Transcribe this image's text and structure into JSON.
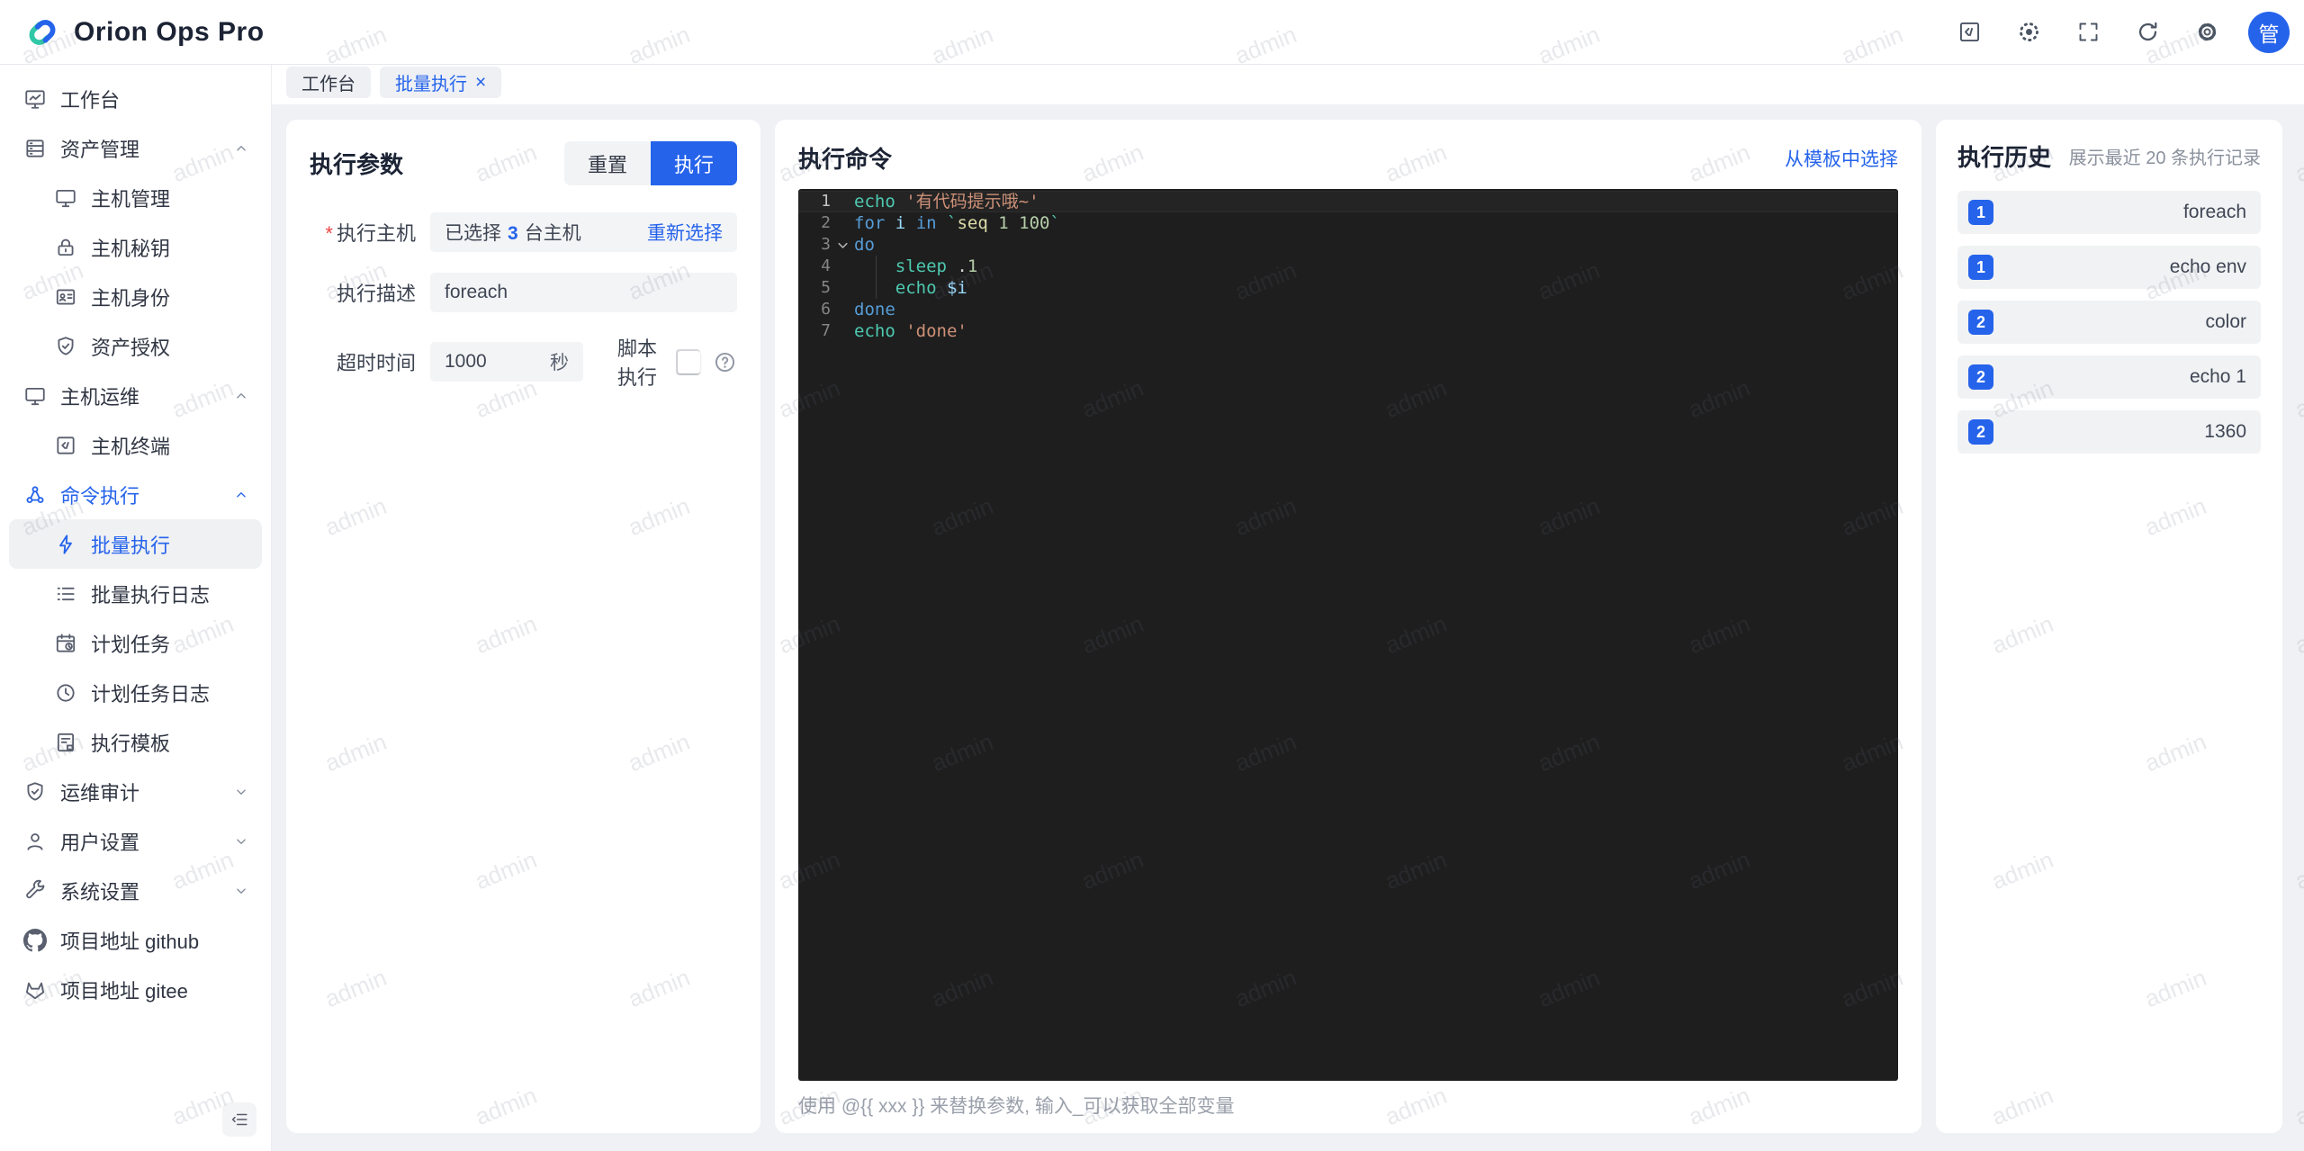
{
  "app": {
    "title": "Orion Ops Pro",
    "watermark": "admin"
  },
  "colors": {
    "primary": "#2563eb",
    "logo_teal": "#2fc7a7",
    "logo_blue": "#2563eb"
  },
  "header": {
    "actions": [
      {
        "name": "code-window-icon",
        "icon": "code-window"
      },
      {
        "name": "theme-sun-icon",
        "icon": "sun"
      },
      {
        "name": "fullscreen-icon",
        "icon": "fullscreen"
      },
      {
        "name": "refresh-icon",
        "icon": "refresh"
      },
      {
        "name": "settings-gear-icon",
        "icon": "gear"
      }
    ],
    "avatar_text": "管"
  },
  "tabs": [
    {
      "label": "工作台",
      "active": false,
      "closable": false
    },
    {
      "label": "批量执行",
      "active": true,
      "closable": true,
      "close_glyph": "×"
    }
  ],
  "sidebar": {
    "items": [
      {
        "label": "工作台",
        "level": 1,
        "icon": "dashboard-monitor-icon"
      },
      {
        "label": "资产管理",
        "level": 1,
        "icon": "server-stack-icon",
        "arrow": "up"
      },
      {
        "label": "主机管理",
        "level": 2,
        "icon": "monitor-icon"
      },
      {
        "label": "主机秘钥",
        "level": 2,
        "icon": "lock-icon"
      },
      {
        "label": "主机身份",
        "level": 2,
        "icon": "id-card-icon"
      },
      {
        "label": "资产授权",
        "level": 2,
        "icon": "shield-check-icon"
      },
      {
        "label": "主机运维",
        "level": 1,
        "icon": "monitor-icon",
        "arrow": "up"
      },
      {
        "label": "主机终端",
        "level": 2,
        "icon": "terminal-icon"
      },
      {
        "label": "命令执行",
        "level": 1,
        "icon": "cluster-icon",
        "arrow": "up",
        "blue": true
      },
      {
        "label": "批量执行",
        "level": 2,
        "icon": "lightning-icon",
        "active": true
      },
      {
        "label": "批量执行日志",
        "level": 2,
        "icon": "list-icon"
      },
      {
        "label": "计划任务",
        "level": 2,
        "icon": "calendar-clock-icon"
      },
      {
        "label": "计划任务日志",
        "level": 2,
        "icon": "clock-icon"
      },
      {
        "label": "执行模板",
        "level": 2,
        "icon": "template-doc-icon"
      },
      {
        "label": "运维审计",
        "level": 1,
        "icon": "shield-check-icon",
        "arrow": "down"
      },
      {
        "label": "用户设置",
        "level": 1,
        "icon": "user-icon",
        "arrow": "down"
      },
      {
        "label": "系统设置",
        "level": 1,
        "icon": "wrench-icon",
        "arrow": "down"
      },
      {
        "label": "项目地址 github",
        "level": 1,
        "icon": "github-icon"
      },
      {
        "label": "项目地址 gitee",
        "level": 1,
        "icon": "gitee-icon"
      }
    ]
  },
  "params_panel": {
    "title": "执行参数",
    "reset_label": "重置",
    "run_label": "执行",
    "host_label": "执行主机",
    "host_selected_prefix": "已选择",
    "host_selected_count": "3",
    "host_selected_suffix": "台主机",
    "host_reselect": "重新选择",
    "desc_label": "执行描述",
    "desc_value": "foreach",
    "timeout_label": "超时时间",
    "timeout_value": "1000",
    "timeout_unit": "秒",
    "script_label": "脚本执行",
    "script_enabled": false
  },
  "command_panel": {
    "title": "执行命令",
    "template_link": "从模板中选择",
    "hint": "使用 @{{ xxx }} 来替换参数, 输入_可以获取全部变量",
    "editor": {
      "lines": [
        {
          "n": 1,
          "active": true,
          "tokens": [
            [
              "fn",
              "echo"
            ],
            [
              "pl",
              " "
            ],
            [
              "str",
              "'有代码提示哦~'"
            ]
          ]
        },
        {
          "n": 2,
          "tokens": [
            [
              "kw",
              "for"
            ],
            [
              "pl",
              " "
            ],
            [
              "vr",
              "i"
            ],
            [
              "pl",
              " "
            ],
            [
              "kw",
              "in"
            ],
            [
              "pl",
              " "
            ],
            [
              "tk",
              "`"
            ],
            [
              "fy",
              "seq"
            ],
            [
              "pl",
              " "
            ],
            [
              "nm",
              "1"
            ],
            [
              "pl",
              " "
            ],
            [
              "nm",
              "100"
            ],
            [
              "tk",
              "`"
            ]
          ]
        },
        {
          "n": 3,
          "fold": true,
          "tokens": [
            [
              "kw",
              "do"
            ]
          ]
        },
        {
          "n": 4,
          "guide": true,
          "tokens": [
            [
              "pl",
              "    "
            ],
            [
              "fn",
              "sleep"
            ],
            [
              "pl",
              " ."
            ],
            [
              "nm",
              "1"
            ]
          ]
        },
        {
          "n": 5,
          "guide": true,
          "tokens": [
            [
              "pl",
              "    "
            ],
            [
              "fn",
              "echo"
            ],
            [
              "pl",
              " "
            ],
            [
              "vr",
              "$i"
            ]
          ]
        },
        {
          "n": 6,
          "tokens": [
            [
              "kw",
              "done"
            ]
          ]
        },
        {
          "n": 7,
          "tokens": [
            [
              "fn",
              "echo"
            ],
            [
              "pl",
              " "
            ],
            [
              "str",
              "'done'"
            ]
          ]
        }
      ]
    }
  },
  "history_panel": {
    "title": "执行历史",
    "subtitle": "展示最近 20 条执行记录",
    "items": [
      {
        "count": "1",
        "name": "foreach"
      },
      {
        "count": "1",
        "name": "echo env"
      },
      {
        "count": "2",
        "name": "color"
      },
      {
        "count": "2",
        "name": "echo 1"
      },
      {
        "count": "2",
        "name": "1360"
      }
    ]
  }
}
